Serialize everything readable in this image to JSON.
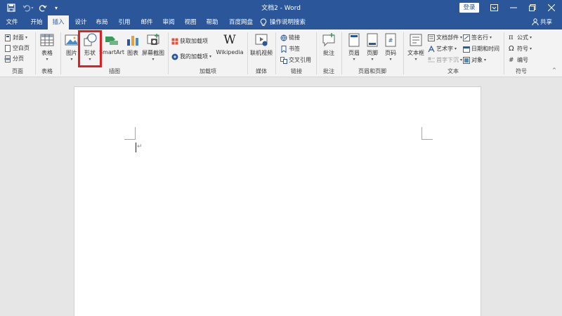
{
  "titlebar": {
    "title": "文档2 - Word",
    "login_label": "登录",
    "icons": {
      "save": "save-icon",
      "undo": "undo-icon",
      "redo": "redo-icon",
      "customize": "quick-access-icon"
    }
  },
  "tabs": [
    "文件",
    "开始",
    "插入",
    "设计",
    "布局",
    "引用",
    "邮件",
    "审阅",
    "视图",
    "帮助",
    "百度网盘"
  ],
  "active_tab": "插入",
  "tell_me": "操作说明搜索",
  "share_label": "共享",
  "ribbon": {
    "pages": {
      "items": [
        "封面",
        "空白页",
        "分页"
      ],
      "group": "页面"
    },
    "tables": {
      "item": "表格",
      "group": "表格"
    },
    "illustrations": {
      "items": [
        "图片",
        "形状",
        "SmartArt",
        "图表",
        "屏幕截图"
      ],
      "group": "插图"
    },
    "addins": {
      "items": [
        "获取加载项",
        "我的加载项"
      ],
      "wiki": "Wikipedia",
      "group": "加载项"
    },
    "media": {
      "item": "联机视频",
      "group": "媒体"
    },
    "links": {
      "items": [
        "链接",
        "书签",
        "交叉引用"
      ],
      "group": "链接"
    },
    "comments": {
      "item": "批注",
      "group": "批注"
    },
    "header_footer": {
      "items": [
        "页眉",
        "页脚",
        "页码"
      ],
      "group": "页眉和页脚"
    },
    "text": {
      "textbox": "文本框",
      "items": [
        "文档部件",
        "艺术字",
        "首字下沉",
        "签名行",
        "日期和时间",
        "对象"
      ],
      "group": "文本"
    },
    "symbols": {
      "items": [
        "公式",
        "符号",
        "编号"
      ],
      "group": "符号"
    }
  },
  "colors": {
    "accent": "#2b579a",
    "highlight": "#e02020"
  }
}
